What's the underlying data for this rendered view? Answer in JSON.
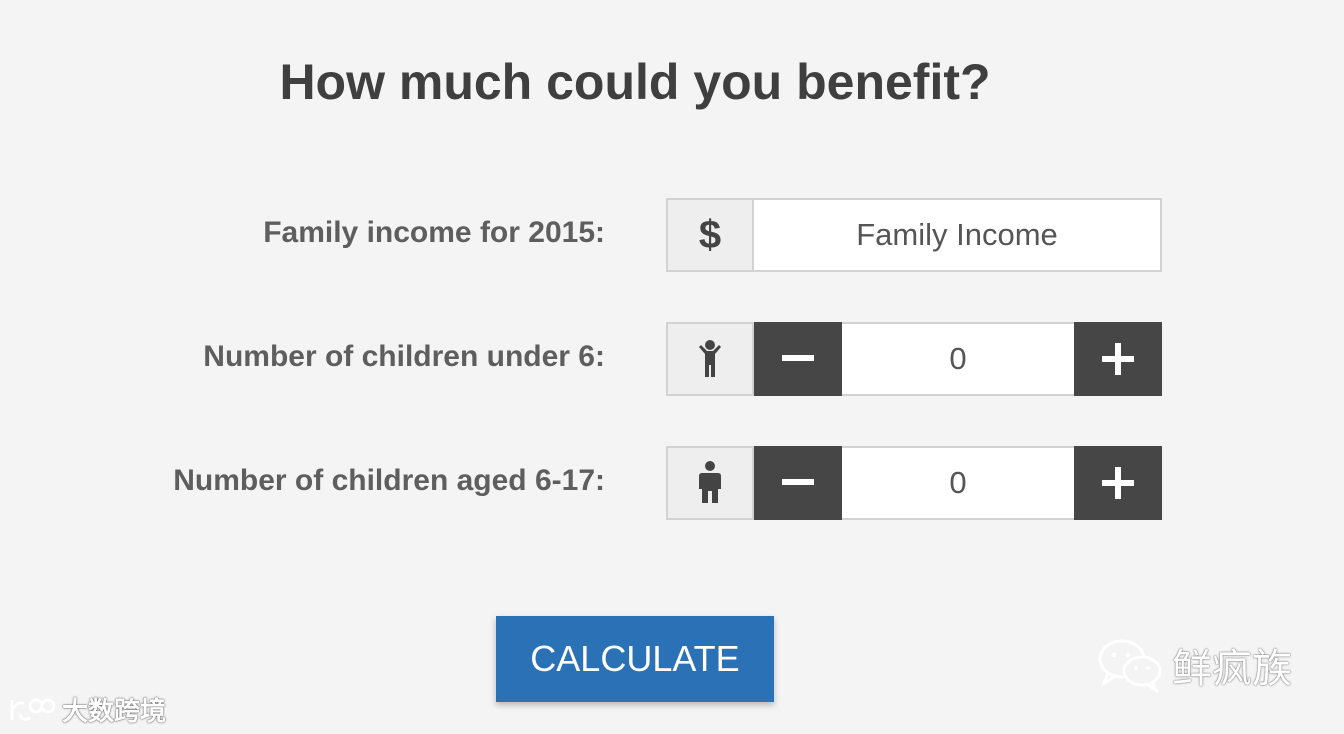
{
  "heading": "How much could you benefit?",
  "income": {
    "label": "Family income for 2015:",
    "currency_symbol": "$",
    "placeholder": "Family Income",
    "value": ""
  },
  "children_under_6": {
    "label": "Number of children under 6:",
    "icon": "small-child-icon",
    "value": "0"
  },
  "children_6_17": {
    "label": "Number of children aged 6-17:",
    "icon": "child-icon",
    "value": "0"
  },
  "calculate_label": "CALCULATE",
  "watermarks": {
    "left": "大数跨境",
    "right": "鲜疯族"
  },
  "colors": {
    "background": "#f4f4f4",
    "stepper_button": "#464646",
    "calculate_button": "#2a72b5",
    "heading_text": "#3f3f3f",
    "label_text": "#5e5e5e"
  }
}
